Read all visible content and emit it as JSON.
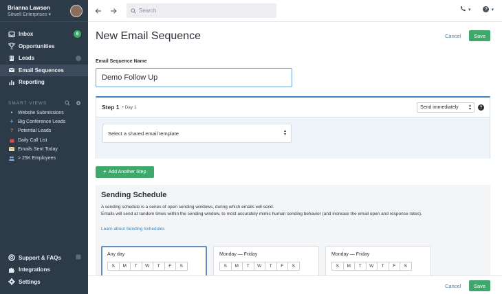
{
  "profile": {
    "name": "Brianna Lawson",
    "org": "Sitwell Enterprises ▾"
  },
  "nav": [
    {
      "label": "Inbox",
      "icon": "inbox-icon",
      "badge": "6"
    },
    {
      "label": "Opportunities",
      "icon": "trophy-icon"
    },
    {
      "label": "Leads",
      "icon": "building-icon"
    },
    {
      "label": "Email Sequences",
      "icon": "email-sequence-icon",
      "active": true
    },
    {
      "label": "Reporting",
      "icon": "bar-chart-icon"
    }
  ],
  "smart_views": {
    "title": "SMART VIEWS",
    "items": [
      {
        "label": "Website Submissions",
        "icon": "dot-icon"
      },
      {
        "label": "Big Conference Leads",
        "icon": "plane-icon"
      },
      {
        "label": "Potential Leads",
        "icon": "question-icon"
      },
      {
        "label": "Daily Call List",
        "icon": "calendar-icon"
      },
      {
        "label": "Emails Sent Today",
        "icon": "envelope-icon"
      },
      {
        "label": "> 25K Employees",
        "icon": "people-icon"
      }
    ]
  },
  "bottom_nav": [
    {
      "label": "Support & FAQs",
      "icon": "lifebuoy-icon"
    },
    {
      "label": "Integrations",
      "icon": "puzzle-icon"
    },
    {
      "label": "Settings",
      "icon": "gear-icon"
    }
  ],
  "topbar": {
    "search_placeholder": "Search",
    "phone_caret": "▾",
    "help_caret": "▾"
  },
  "page": {
    "title": "New Email Sequence",
    "cancel": "Cancel",
    "save": "Save",
    "name_label": "Email Sequence Name",
    "name_value": "Demo Follow Up"
  },
  "step": {
    "title": "Step 1",
    "day": "• Day 1",
    "send_option": "Send immediately",
    "template_placeholder": "Select a shared email template"
  },
  "add_step": "Add Another Step",
  "schedule": {
    "title": "Sending Schedule",
    "line1": "A sending schedule is a series of open sending windows, during which emails will send.",
    "line2": "Emails will send at random times within the sending window, to most accurately mimic human sending behavior (and increase the email open and response rates).",
    "link": "Learn about Sending Schedules",
    "cards": [
      {
        "title": "Any day",
        "selected": true
      },
      {
        "title": "Monday — Friday"
      },
      {
        "title": "Monday — Friday"
      }
    ],
    "days": [
      "S",
      "M",
      "T",
      "W",
      "T",
      "F",
      "S"
    ]
  },
  "footer": {
    "cancel": "Cancel",
    "save": "Save"
  },
  "colors": {
    "accent_green": "#3ea96b",
    "sidebar": "#2d3a48",
    "link_blue": "#3d7fb0",
    "step_border": "#3f7fc0"
  }
}
